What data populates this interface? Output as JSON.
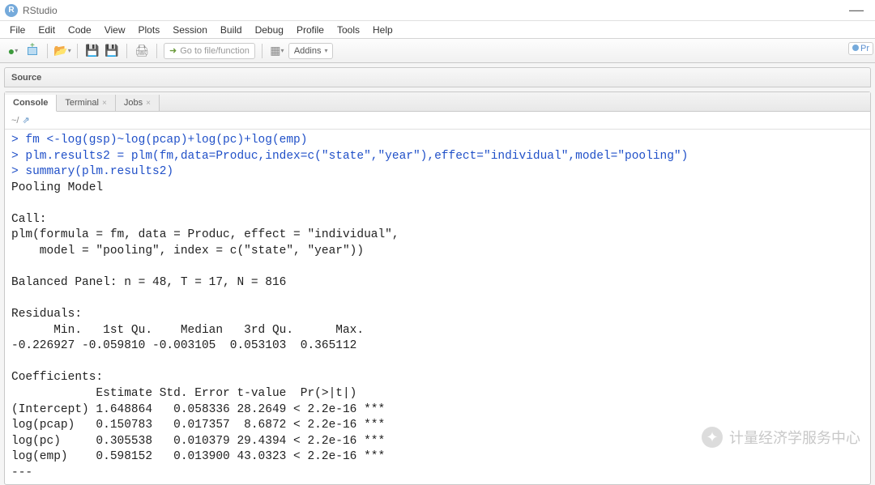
{
  "window": {
    "title": "RStudio"
  },
  "menubar": [
    "File",
    "Edit",
    "Code",
    "View",
    "Plots",
    "Session",
    "Build",
    "Debug",
    "Profile",
    "Tools",
    "Help"
  ],
  "toolbar": {
    "goto_placeholder": "Go to file/function",
    "addins_label": "Addins"
  },
  "source_label": "Source",
  "tabs": {
    "console": "Console",
    "terminal": "Terminal",
    "jobs": "Jobs"
  },
  "subbar": {
    "path": "~/"
  },
  "right_badge": "Pr",
  "console_lines": [
    {
      "t": "cmd",
      "prompt": "> ",
      "text": "fm <-log(gsp)~log(pcap)+log(pc)+log(emp)"
    },
    {
      "t": "cmd",
      "prompt": "> ",
      "text": "plm.results2 = plm(fm,data=Produc,index=c(\"state\",\"year\"),effect=\"individual\",model=\"pooling\")"
    },
    {
      "t": "cmd",
      "prompt": "> ",
      "text": "summary(plm.results2)"
    },
    {
      "t": "out",
      "text": "Pooling Model"
    },
    {
      "t": "out",
      "text": ""
    },
    {
      "t": "out",
      "text": "Call:"
    },
    {
      "t": "out",
      "text": "plm(formula = fm, data = Produc, effect = \"individual\", "
    },
    {
      "t": "out",
      "text": "    model = \"pooling\", index = c(\"state\", \"year\"))"
    },
    {
      "t": "out",
      "text": ""
    },
    {
      "t": "out",
      "text": "Balanced Panel: n = 48, T = 17, N = 816"
    },
    {
      "t": "out",
      "text": ""
    },
    {
      "t": "out",
      "text": "Residuals:"
    },
    {
      "t": "out",
      "text": "      Min.   1st Qu.    Median   3rd Qu.      Max. "
    },
    {
      "t": "out",
      "text": "-0.226927 -0.059810 -0.003105  0.053103  0.365112 "
    },
    {
      "t": "out",
      "text": ""
    },
    {
      "t": "out",
      "text": "Coefficients:"
    },
    {
      "t": "out",
      "text": "            Estimate Std. Error t-value  Pr(>|t|)    "
    },
    {
      "t": "out",
      "text": "(Intercept) 1.648864   0.058336 28.2649 < 2.2e-16 ***"
    },
    {
      "t": "out",
      "text": "log(pcap)   0.150783   0.017357  8.6872 < 2.2e-16 ***"
    },
    {
      "t": "out",
      "text": "log(pc)     0.305538   0.010379 29.4394 < 2.2e-16 ***"
    },
    {
      "t": "out",
      "text": "log(emp)    0.598152   0.013900 43.0323 < 2.2e-16 ***"
    },
    {
      "t": "out",
      "text": "---"
    }
  ],
  "watermark": "计量经济学服务中心"
}
